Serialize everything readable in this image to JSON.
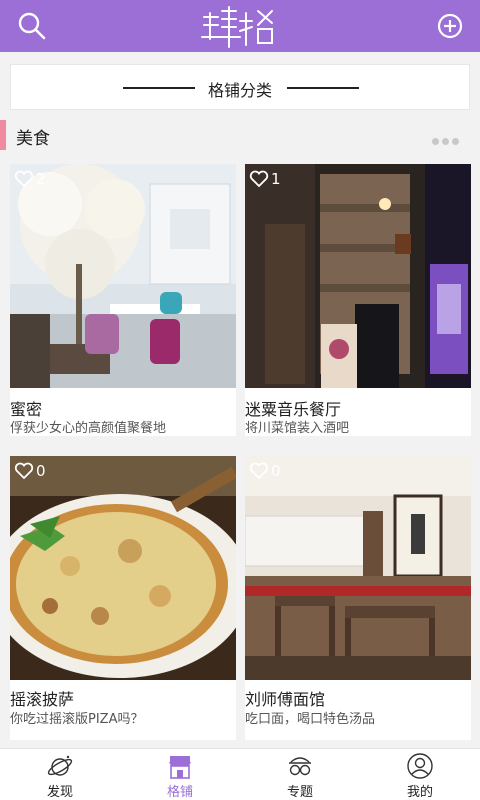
{
  "header": {
    "logo_text": "肆格",
    "search_icon": "search-icon",
    "add_icon": "plus-circle-icon",
    "bg_color": "#9b6fd6"
  },
  "section": {
    "title": "格铺分类"
  },
  "category": {
    "label": "美食",
    "accent_color": "#f08aa0",
    "more_icon": "ellipsis-icon"
  },
  "cards": [
    {
      "likes": "2",
      "name": "蜜密",
      "desc": "俘获少女心的高颜值聚餐地"
    },
    {
      "likes": "1",
      "name": "迷粟音乐餐厅",
      "desc": "将川菜馆装入酒吧"
    },
    {
      "likes": "0",
      "name": "摇滚披萨",
      "desc": "你吃过摇滚版PIZA吗？"
    },
    {
      "likes": "0",
      "name": "刘师傅面馆",
      "desc": "吃口面，喝口特色汤品"
    }
  ],
  "tabs": [
    {
      "label": "发现",
      "icon": "planet-icon",
      "active": false
    },
    {
      "label": "格铺",
      "icon": "shop-icon",
      "active": true
    },
    {
      "label": "专题",
      "icon": "glasses-icon",
      "active": false
    },
    {
      "label": "我的",
      "icon": "user-icon",
      "active": false
    }
  ]
}
